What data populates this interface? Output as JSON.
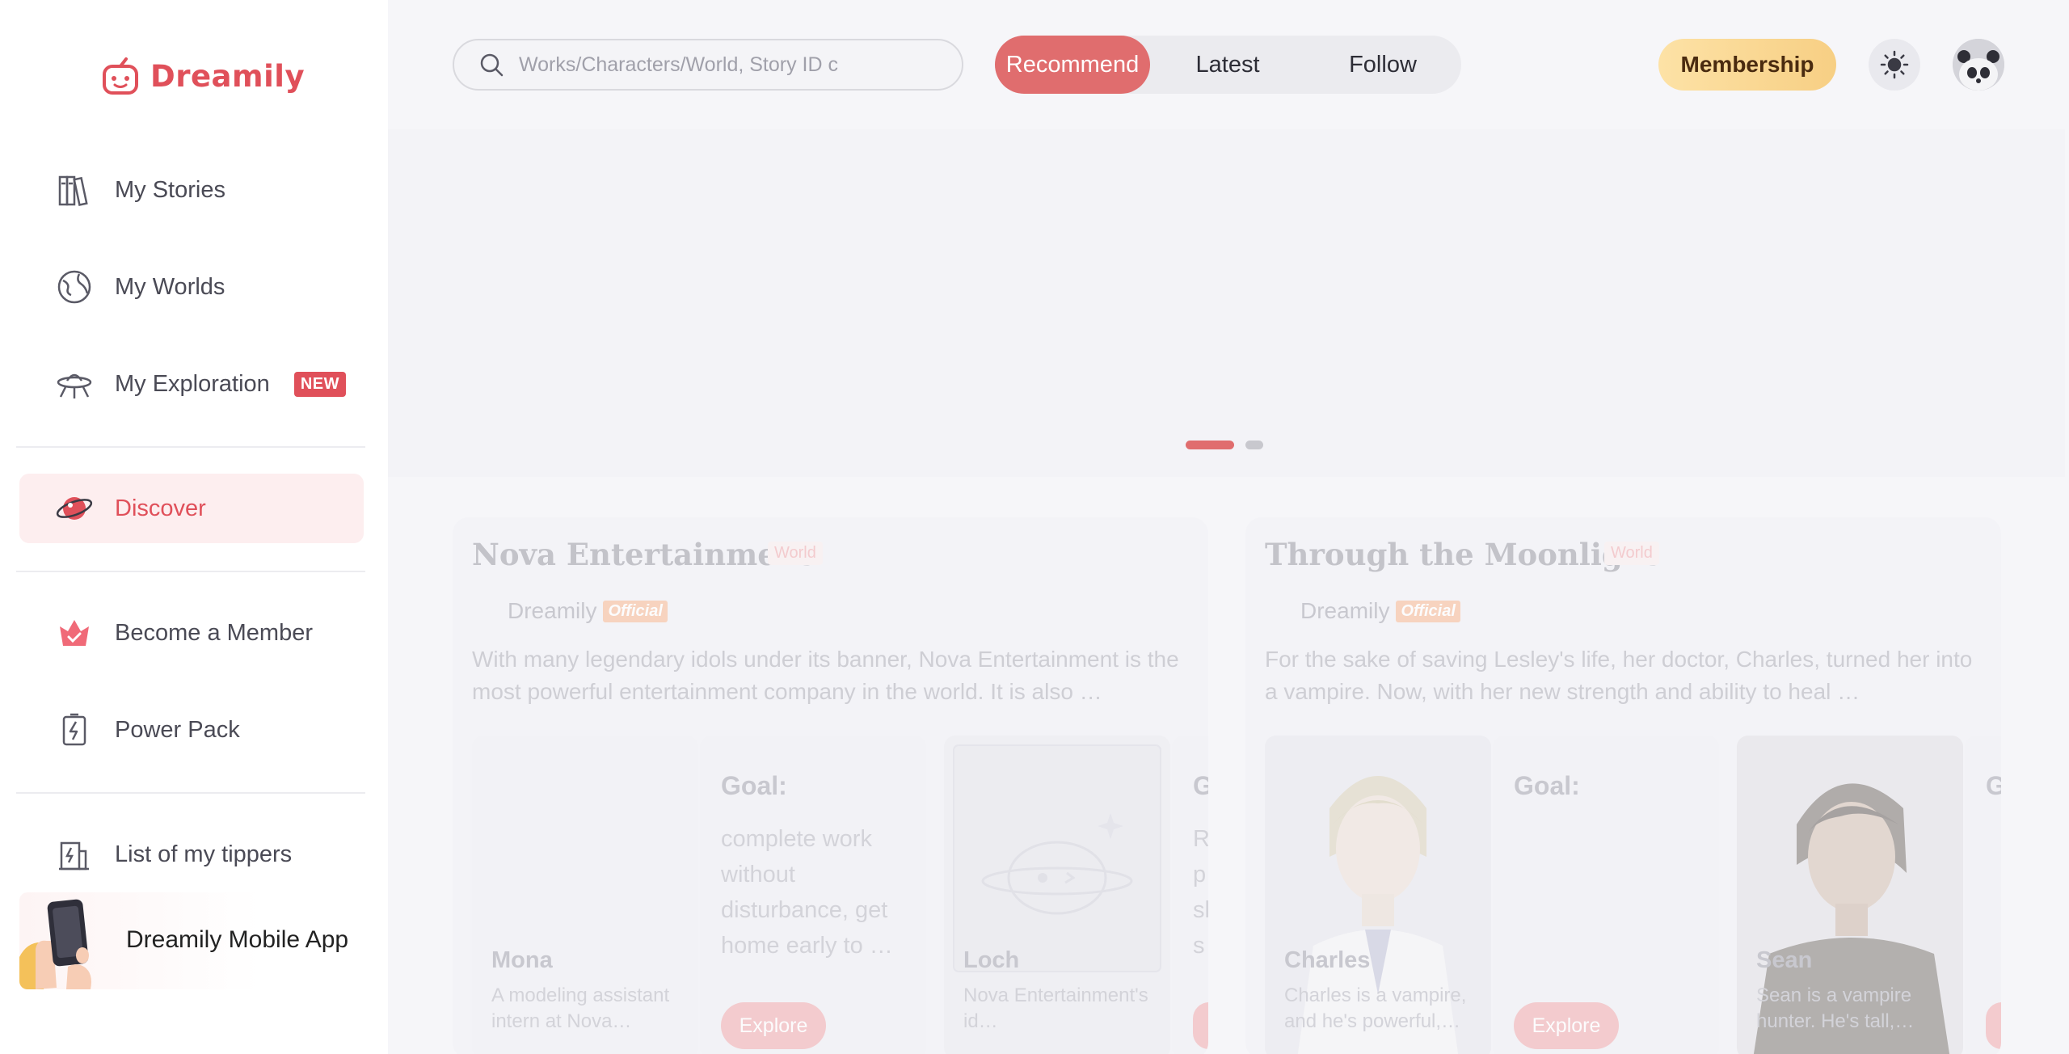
{
  "app": {
    "brand": "Dreamily",
    "brand_color": "#e0505a"
  },
  "sidebar": {
    "items": [
      {
        "label": "My Stories",
        "icon": "books-icon"
      },
      {
        "label": "My Worlds",
        "icon": "globe-icon"
      },
      {
        "label": "My Exploration",
        "icon": "ufo-icon",
        "badge": "NEW"
      },
      {
        "label": "Discover",
        "icon": "planet-icon",
        "active": true
      },
      {
        "label": "Become a Member",
        "icon": "crown-icon"
      },
      {
        "label": "Power Pack",
        "icon": "battery-icon"
      },
      {
        "label": "List of my tippers",
        "icon": "tip-jar-icon"
      }
    ],
    "app_banner": {
      "label": "Dreamily Mobile App"
    }
  },
  "header": {
    "search_placeholder": "Works/Characters/World, Story ID c",
    "tabs": [
      {
        "label": "Recommend",
        "active": true
      },
      {
        "label": "Latest"
      },
      {
        "label": "Follow"
      }
    ],
    "membership_label": "Membership",
    "theme_icon": "sun-icon"
  },
  "carousel": {
    "slides": 2,
    "active_index": 0
  },
  "worlds": [
    {
      "title": "Nova Entertainment",
      "tag": "World",
      "author": "Dreamily",
      "author_badge": "Official",
      "description": "With many legendary idols under its banner, Nova Entertainment is the most powerful entertainment company in the world. It is also …",
      "characters": [
        {
          "name": "Mona",
          "description": "A modeling assistant intern at Nova…"
        },
        {
          "name": "Loch",
          "description": "Nova Entertainment's id…"
        }
      ],
      "goals": [
        {
          "title": "Goal:",
          "text": "complete work without disturbance, get home early to …",
          "button": "Explore"
        },
        {
          "title": "G",
          "text": "R p sl s",
          "button": ""
        }
      ]
    },
    {
      "title": "Through the Moonlight",
      "tag": "World",
      "author": "Dreamily",
      "author_badge": "Official",
      "description": "For the sake of saving Lesley's life, her doctor, Charles, turned her into a vampire. Now, with her new strength and ability to heal …",
      "characters": [
        {
          "name": "Charles",
          "description": "Charles is a vampire, and he's powerful,…"
        },
        {
          "name": "Sean",
          "description": "Sean is a vampire hunter. He's tall,…"
        }
      ],
      "goals": [
        {
          "title": "Goal:",
          "text": "",
          "button": "Explore"
        },
        {
          "title": "G",
          "text": "",
          "button": ""
        }
      ]
    }
  ]
}
